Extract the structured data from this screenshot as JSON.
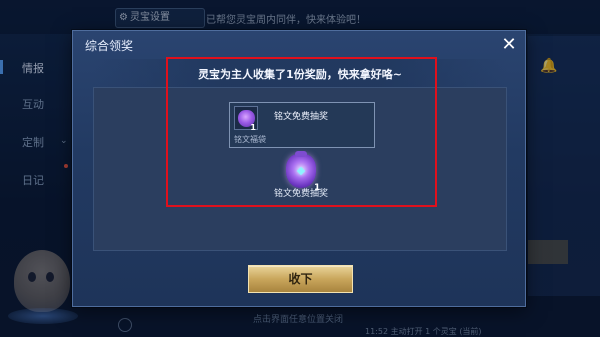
{
  "background": {
    "top_pill_label": "灵宝设置",
    "notice_text": "已帮您灵宝周内同伴，快来体验吧！",
    "sidebar": [
      {
        "label": "情报",
        "active": true
      },
      {
        "label": "互动",
        "active": false
      },
      {
        "label": "定制",
        "active": false
      },
      {
        "label": "日记",
        "active": false
      }
    ],
    "bottom_hint": "点击界面任意位置关闭",
    "bottom_right_text": "11:52 主动打开 1 个灵宝 (当前)"
  },
  "dialog": {
    "title": "综合领奖",
    "close_icon": "close-icon",
    "header_text": "灵宝为主人收集了1份奖励，快来拿好咯~",
    "tooltip": {
      "name": "铭文免费抽奖",
      "quantity": "1",
      "category": "铭文福袋",
      "icon": "purple-bag-icon"
    },
    "reward": {
      "name": "铭文免费抽奖",
      "quantity": "1",
      "icon": "inscription-bag-icon"
    },
    "receive_button_label": "收下"
  },
  "colors": {
    "highlight": "#e0101c",
    "button_gold": "#c9a65c",
    "dialog_bg": "#223a62"
  }
}
